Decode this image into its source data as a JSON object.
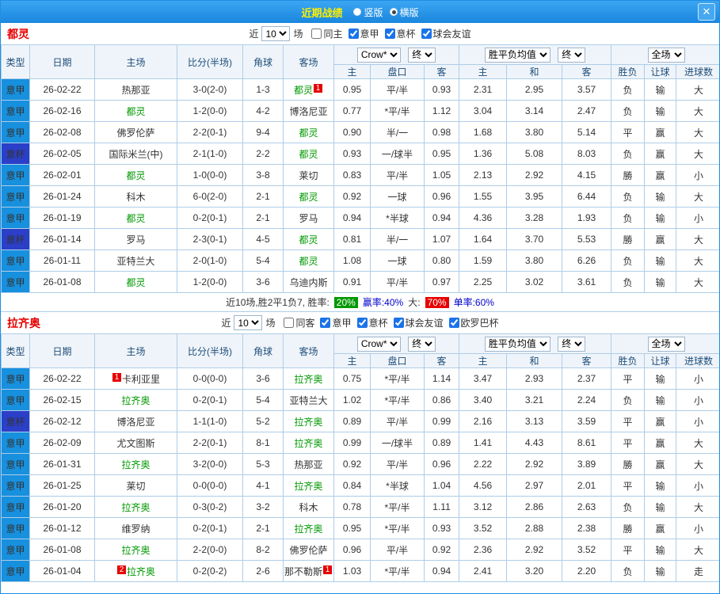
{
  "colors": {
    "titlebar_blue": "#1E8EE4",
    "title_yellow": "#FFF000",
    "seriea_type_blue": "#1790DE",
    "cup_type_blue": "#2B3FC8",
    "focus_team_green": "#009900",
    "score_red": "#E60000",
    "push_blue": "#0000EE",
    "grid_border_blue": "#AECDE8"
  },
  "titlebar": {
    "title": "近期战绩",
    "radios": [
      {
        "label": "竖版",
        "checked": false
      },
      {
        "label": "横版",
        "checked": true
      }
    ],
    "close_icon": "✕"
  },
  "table_headers": {
    "type": "类型",
    "date": "日期",
    "home": "主场",
    "score": "比分(半场)",
    "corner": "角球",
    "away": "客场",
    "odds_home": "主",
    "odds_line": "盘口",
    "odds_away": "客",
    "avg_home": "主",
    "avg_draw": "和",
    "avg_away": "客",
    "result": "胜负",
    "handicap": "让球",
    "goals": "进球数"
  },
  "sections": [
    {
      "team": "都灵",
      "filter": {
        "near": "近",
        "count": "10",
        "games": "场",
        "checkboxes": [
          {
            "label": "同主",
            "checked": false
          },
          {
            "label": "意甲",
            "checked": true
          },
          {
            "label": "意杯",
            "checked": true
          },
          {
            "label": "球会友谊",
            "checked": true
          }
        ]
      },
      "selects": {
        "company": "Crow*",
        "company_time": "终",
        "avg": "胜平负均值",
        "avg_time": "终",
        "scope": "全场"
      },
      "rows": [
        {
          "type": "意甲",
          "date": "26-02-22",
          "home": "热那亚",
          "home_focus": false,
          "home_badge": "",
          "score": "3-0(2-0)",
          "corners": "1-3",
          "away": "都灵",
          "away_focus": true,
          "away_badge": "1",
          "odds": [
            "0.95",
            "平/半",
            "0.93"
          ],
          "avg": [
            "2.31",
            "2.95",
            "3.57"
          ],
          "result": "负",
          "handicap": "输",
          "goals": "大"
        },
        {
          "type": "意甲",
          "date": "26-02-16",
          "home": "都灵",
          "home_focus": true,
          "home_badge": "",
          "score": "1-2(0-0)",
          "corners": "4-2",
          "away": "博洛尼亚",
          "away_focus": false,
          "away_badge": "",
          "odds": [
            "0.77",
            "*平/半",
            "1.12"
          ],
          "avg": [
            "3.04",
            "3.14",
            "2.47"
          ],
          "result": "负",
          "handicap": "输",
          "goals": "大"
        },
        {
          "type": "意甲",
          "date": "26-02-08",
          "home": "佛罗伦萨",
          "home_focus": false,
          "home_badge": "",
          "score": "2-2(0-1)",
          "corners": "9-4",
          "away": "都灵",
          "away_focus": true,
          "away_badge": "",
          "odds": [
            "0.90",
            "半/一",
            "0.98"
          ],
          "avg": [
            "1.68",
            "3.80",
            "5.14"
          ],
          "result": "平",
          "handicap": "赢",
          "goals": "大"
        },
        {
          "type": "意杯",
          "date": "26-02-05",
          "home": "国际米兰(中)",
          "home_focus": false,
          "home_badge": "",
          "score": "2-1(1-0)",
          "corners": "2-2",
          "away": "都灵",
          "away_focus": true,
          "away_badge": "",
          "odds": [
            "0.93",
            "一/球半",
            "0.95"
          ],
          "avg": [
            "1.36",
            "5.08",
            "8.03"
          ],
          "result": "负",
          "handicap": "赢",
          "goals": "大"
        },
        {
          "type": "意甲",
          "date": "26-02-01",
          "home": "都灵",
          "home_focus": true,
          "home_badge": "",
          "score": "1-0(0-0)",
          "corners": "3-8",
          "away": "莱切",
          "away_focus": false,
          "away_badge": "",
          "odds": [
            "0.83",
            "平/半",
            "1.05"
          ],
          "avg": [
            "2.13",
            "2.92",
            "4.15"
          ],
          "result": "勝",
          "handicap": "赢",
          "goals": "小"
        },
        {
          "type": "意甲",
          "date": "26-01-24",
          "home": "科木",
          "home_focus": false,
          "home_badge": "",
          "score": "6-0(2-0)",
          "corners": "2-1",
          "away": "都灵",
          "away_focus": true,
          "away_badge": "",
          "odds": [
            "0.92",
            "一球",
            "0.96"
          ],
          "avg": [
            "1.55",
            "3.95",
            "6.44"
          ],
          "result": "负",
          "handicap": "输",
          "goals": "大"
        },
        {
          "type": "意甲",
          "date": "26-01-19",
          "home": "都灵",
          "home_focus": true,
          "home_badge": "",
          "score": "0-2(0-1)",
          "corners": "2-1",
          "away": "罗马",
          "away_focus": false,
          "away_badge": "",
          "odds": [
            "0.94",
            "*半球",
            "0.94"
          ],
          "avg": [
            "4.36",
            "3.28",
            "1.93"
          ],
          "result": "负",
          "handicap": "输",
          "goals": "小"
        },
        {
          "type": "意杯",
          "date": "26-01-14",
          "home": "罗马",
          "home_focus": false,
          "home_badge": "",
          "score": "2-3(0-1)",
          "corners": "4-5",
          "away": "都灵",
          "away_focus": true,
          "away_badge": "",
          "odds": [
            "0.81",
            "半/一",
            "1.07"
          ],
          "avg": [
            "1.64",
            "3.70",
            "5.53"
          ],
          "result": "勝",
          "handicap": "赢",
          "goals": "大"
        },
        {
          "type": "意甲",
          "date": "26-01-11",
          "home": "亚特兰大",
          "home_focus": false,
          "home_badge": "",
          "score": "2-0(1-0)",
          "corners": "5-4",
          "away": "都灵",
          "away_focus": true,
          "away_badge": "",
          "odds": [
            "1.08",
            "一球",
            "0.80"
          ],
          "avg": [
            "1.59",
            "3.80",
            "6.26"
          ],
          "result": "负",
          "handicap": "输",
          "goals": "大"
        },
        {
          "type": "意甲",
          "date": "26-01-08",
          "home": "都灵",
          "home_focus": true,
          "home_badge": "",
          "score": "1-2(0-0)",
          "corners": "3-6",
          "away": "乌迪内斯",
          "away_focus": false,
          "away_badge": "",
          "odds": [
            "0.91",
            "平/半",
            "0.97"
          ],
          "avg": [
            "2.25",
            "3.02",
            "3.61"
          ],
          "result": "负",
          "handicap": "输",
          "goals": "大"
        }
      ],
      "summary": [
        {
          "text": "近10场,胜2平1负7, 胜率:",
          "style": "plain"
        },
        {
          "text": "20%",
          "style": "green"
        },
        {
          "text": "赢率:40%",
          "style": "blue"
        },
        {
          "text": "大:",
          "style": "plain"
        },
        {
          "text": "70%",
          "style": "red"
        },
        {
          "text": "单率:60%",
          "style": "blue"
        }
      ]
    },
    {
      "team": "拉齐奥",
      "filter": {
        "near": "近",
        "count": "10",
        "games": "场",
        "checkboxes": [
          {
            "label": "同客",
            "checked": false
          },
          {
            "label": "意甲",
            "checked": true
          },
          {
            "label": "意杯",
            "checked": true
          },
          {
            "label": "球会友谊",
            "checked": true
          },
          {
            "label": "欧罗巴杯",
            "checked": true
          }
        ]
      },
      "selects": {
        "company": "Crow*",
        "company_time": "终",
        "avg": "胜平负均值",
        "avg_time": "终",
        "scope": "全场"
      },
      "rows": [
        {
          "type": "意甲",
          "date": "26-02-22",
          "home": "卡利亚里",
          "home_focus": false,
          "home_badge": "1",
          "score": "0-0(0-0)",
          "corners": "3-6",
          "away": "拉齐奥",
          "away_focus": true,
          "away_badge": "",
          "odds": [
            "0.75",
            "*平/半",
            "1.14"
          ],
          "avg": [
            "3.47",
            "2.93",
            "2.37"
          ],
          "result": "平",
          "handicap": "输",
          "goals": "小"
        },
        {
          "type": "意甲",
          "date": "26-02-15",
          "home": "拉齐奥",
          "home_focus": true,
          "home_badge": "",
          "score": "0-2(0-1)",
          "corners": "5-4",
          "away": "亚特兰大",
          "away_focus": false,
          "away_badge": "",
          "odds": [
            "1.02",
            "*平/半",
            "0.86"
          ],
          "avg": [
            "3.40",
            "3.21",
            "2.24"
          ],
          "result": "负",
          "handicap": "输",
          "goals": "小"
        },
        {
          "type": "意杯",
          "date": "26-02-12",
          "home": "博洛尼亚",
          "home_focus": false,
          "home_badge": "",
          "score": "1-1(1-0)",
          "corners": "5-2",
          "away": "拉齐奥",
          "away_focus": true,
          "away_badge": "",
          "odds": [
            "0.89",
            "平/半",
            "0.99"
          ],
          "avg": [
            "2.16",
            "3.13",
            "3.59"
          ],
          "result": "平",
          "handicap": "赢",
          "goals": "小"
        },
        {
          "type": "意甲",
          "date": "26-02-09",
          "home": "尤文图斯",
          "home_focus": false,
          "home_badge": "",
          "score": "2-2(0-1)",
          "corners": "8-1",
          "away": "拉齐奥",
          "away_focus": true,
          "away_badge": "",
          "odds": [
            "0.99",
            "一/球半",
            "0.89"
          ],
          "avg": [
            "1.41",
            "4.43",
            "8.61"
          ],
          "result": "平",
          "handicap": "赢",
          "goals": "大"
        },
        {
          "type": "意甲",
          "date": "26-01-31",
          "home": "拉齐奥",
          "home_focus": true,
          "home_badge": "",
          "score": "3-2(0-0)",
          "corners": "5-3",
          "away": "热那亚",
          "away_focus": false,
          "away_badge": "",
          "odds": [
            "0.92",
            "平/半",
            "0.96"
          ],
          "avg": [
            "2.22",
            "2.92",
            "3.89"
          ],
          "result": "勝",
          "handicap": "赢",
          "goals": "大"
        },
        {
          "type": "意甲",
          "date": "26-01-25",
          "home": "莱切",
          "home_focus": false,
          "home_badge": "",
          "score": "0-0(0-0)",
          "corners": "4-1",
          "away": "拉齐奥",
          "away_focus": true,
          "away_badge": "",
          "odds": [
            "0.84",
            "*半球",
            "1.04"
          ],
          "avg": [
            "4.56",
            "2.97",
            "2.01"
          ],
          "result": "平",
          "handicap": "输",
          "goals": "小"
        },
        {
          "type": "意甲",
          "date": "26-01-20",
          "home": "拉齐奥",
          "home_focus": true,
          "home_badge": "",
          "score": "0-3(0-2)",
          "corners": "3-2",
          "away": "科木",
          "away_focus": false,
          "away_badge": "",
          "odds": [
            "0.78",
            "*平/半",
            "1.11"
          ],
          "avg": [
            "3.12",
            "2.86",
            "2.63"
          ],
          "result": "负",
          "handicap": "输",
          "goals": "大"
        },
        {
          "type": "意甲",
          "date": "26-01-12",
          "home": "维罗纳",
          "home_focus": false,
          "home_badge": "",
          "score": "0-2(0-1)",
          "corners": "2-1",
          "away": "拉齐奥",
          "away_focus": true,
          "away_badge": "",
          "odds": [
            "0.95",
            "*平/半",
            "0.93"
          ],
          "avg": [
            "3.52",
            "2.88",
            "2.38"
          ],
          "result": "勝",
          "handicap": "赢",
          "goals": "小"
        },
        {
          "type": "意甲",
          "date": "26-01-08",
          "home": "拉齐奥",
          "home_focus": true,
          "home_badge": "",
          "score": "2-2(0-0)",
          "corners": "8-2",
          "away": "佛罗伦萨",
          "away_focus": false,
          "away_badge": "",
          "odds": [
            "0.96",
            "平/半",
            "0.92"
          ],
          "avg": [
            "2.36",
            "2.92",
            "3.52"
          ],
          "result": "平",
          "handicap": "输",
          "goals": "大"
        },
        {
          "type": "意甲",
          "date": "26-01-04",
          "home": "拉齐奥",
          "home_focus": true,
          "home_badge": "2",
          "score": "0-2(0-2)",
          "corners": "2-6",
          "away": "那不勒斯",
          "away_focus": false,
          "away_badge": "1",
          "odds": [
            "1.03",
            "*平/半",
            "0.94"
          ],
          "avg": [
            "2.41",
            "3.20",
            "2.20"
          ],
          "result": "负",
          "handicap": "输",
          "goals": "走"
        }
      ]
    }
  ]
}
